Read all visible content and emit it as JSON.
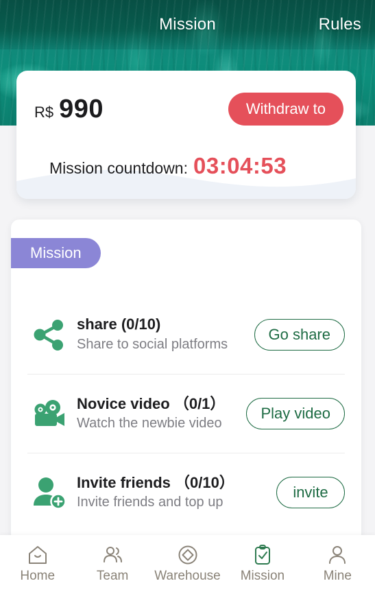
{
  "header": {
    "title": "Mission",
    "rules_label": "Rules"
  },
  "balance": {
    "currency": "R$",
    "amount": "990",
    "withdraw_label": "Withdraw to",
    "countdown_label": "Mission countdown:",
    "countdown_value": "03:04:53"
  },
  "mission_panel": {
    "tab_label": "Mission",
    "tasks": [
      {
        "icon": "share-icon",
        "title": "share (0/10)",
        "subtitle": "Share to social platforms",
        "button": "Go share"
      },
      {
        "icon": "video-camera-icon",
        "title": "Novice video （0/1）",
        "subtitle": "Watch the newbie video",
        "button": "Play video"
      },
      {
        "icon": "invite-friend-icon",
        "title": "Invite friends （0/10）",
        "subtitle": "Invite friends and top up",
        "button": "invite"
      }
    ]
  },
  "bottom_nav": {
    "active": "Mission",
    "items": [
      {
        "icon": "home-icon",
        "label": "Home"
      },
      {
        "icon": "team-icon",
        "label": "Team"
      },
      {
        "icon": "warehouse-icon",
        "label": "Warehouse"
      },
      {
        "icon": "clipboard-check-icon",
        "label": "Mission"
      },
      {
        "icon": "person-icon",
        "label": "Mine"
      }
    ]
  },
  "colors": {
    "banner_teal": "#0c7f6e",
    "accent_red": "#e5505a",
    "tab_purple": "#8b86d6",
    "task_green": "#3ba272",
    "button_green": "#1d6b43",
    "nav_gray": "#8a8378",
    "page_bg": "#f4f4f6"
  }
}
